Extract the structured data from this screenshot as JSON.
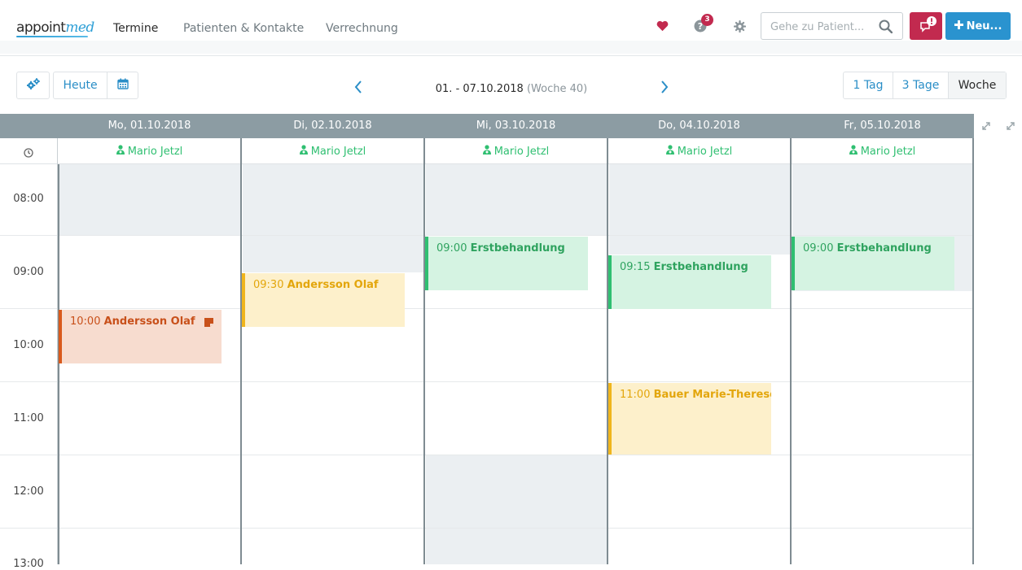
{
  "nav": {
    "logo_main": "appoint",
    "logo_accent": "med",
    "links": [
      {
        "label": "Termine",
        "active": true
      },
      {
        "label": "Patienten & Kontakte",
        "active": false
      },
      {
        "label": "Verrechnung",
        "active": false
      }
    ],
    "help_badge": "3",
    "search_placeholder": "Gehe zu Patient...",
    "new_button": "Neu...",
    "icons": {
      "favorites": "heart-icon",
      "help": "question-icon",
      "settings": "gear-icon",
      "search": "search-icon",
      "messages": "alert-bubble-icon",
      "new": "plus-icon"
    },
    "colors": {
      "accent": "#2a93cf",
      "alert": "#c22a4f",
      "favorite": "#c22a4f"
    }
  },
  "toolbar": {
    "today": "Heute",
    "range_dates": "01. - 07.10.2018",
    "range_week": "(Woche 40)",
    "views": [
      {
        "label": "1 Tag",
        "active": false
      },
      {
        "label": "3 Tage",
        "active": false
      },
      {
        "label": "Woche",
        "active": true
      }
    ]
  },
  "calendar": {
    "days": [
      {
        "label": "Mo, 01.10.2018",
        "resource": "Mario Jetzl"
      },
      {
        "label": "Di, 02.10.2018",
        "resource": "Mario Jetzl"
      },
      {
        "label": "Mi, 03.10.2018",
        "resource": "Mario Jetzl"
      },
      {
        "label": "Do, 04.10.2018",
        "resource": "Mario Jetzl"
      },
      {
        "label": "Fr, 05.10.2018",
        "resource": "Mario Jetzl"
      }
    ],
    "hours": [
      "08:00",
      "09:00",
      "10:00",
      "11:00",
      "12:00",
      "13:00"
    ],
    "appointments": [
      {
        "day": 0,
        "time": "10:00",
        "name": "Andersson Olaf",
        "color": "orange",
        "has_note": true
      },
      {
        "day": 1,
        "time": "09:30",
        "name": "Andersson Olaf",
        "color": "yellow",
        "has_note": false
      },
      {
        "day": 2,
        "time": "09:00",
        "name": "Erstbehandlung",
        "color": "green",
        "has_note": false
      },
      {
        "day": 3,
        "time": "09:15",
        "name": "Erstbehandlung",
        "color": "green",
        "has_note": false
      },
      {
        "day": 3,
        "time": "11:00",
        "name": "Bauer Marie-Therese",
        "color": "yellow",
        "has_note": false
      },
      {
        "day": 4,
        "time": "09:00",
        "name": "Erstbehandlung",
        "color": "green",
        "has_note": false
      }
    ],
    "colors": {
      "header": "#8c9ca3",
      "resource": "#2fbf71",
      "blocked": "#ebeff2"
    }
  }
}
